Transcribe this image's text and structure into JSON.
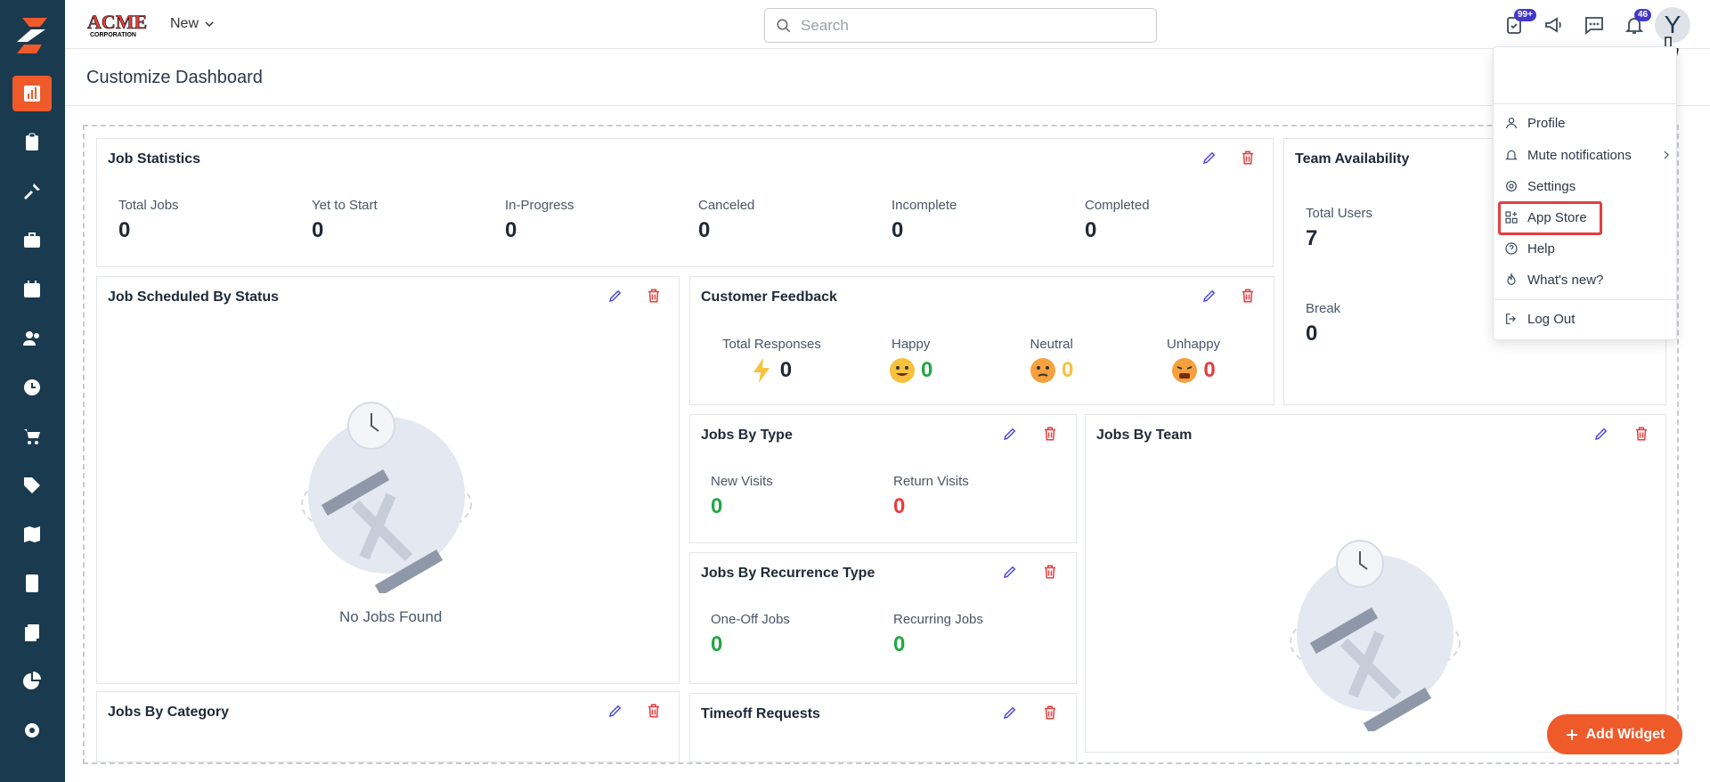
{
  "header": {
    "new_label": "New",
    "search_placeholder": "Search",
    "tasks_badge": "99+",
    "notifications_badge": "46",
    "avatar_letter": "Y"
  },
  "page": {
    "title": "Customize Dashboard"
  },
  "cards": {
    "job_statistics": {
      "title": "Job Statistics",
      "stats": [
        {
          "label": "Total Jobs",
          "value": "0"
        },
        {
          "label": "Yet to Start",
          "value": "0"
        },
        {
          "label": "In-Progress",
          "value": "0"
        },
        {
          "label": "Canceled",
          "value": "0"
        },
        {
          "label": "Incomplete",
          "value": "0"
        },
        {
          "label": "Completed",
          "value": "0"
        }
      ]
    },
    "team_availability": {
      "title": "Team Availability",
      "stats": [
        {
          "label": "Total Users",
          "value": "7"
        },
        {
          "label": "Break",
          "value": "0"
        }
      ]
    },
    "job_scheduled": {
      "title": "Job Scheduled By Status",
      "empty": "No Jobs Found"
    },
    "customer_feedback": {
      "title": "Customer Feedback",
      "stats": [
        {
          "label": "Total Responses",
          "value": "0"
        },
        {
          "label": "Happy",
          "value": "0"
        },
        {
          "label": "Neutral",
          "value": "0"
        },
        {
          "label": "Unhappy",
          "value": "0"
        }
      ]
    },
    "jobs_by_type": {
      "title": "Jobs By Type",
      "stats": [
        {
          "label": "New Visits",
          "value": "0"
        },
        {
          "label": "Return Visits",
          "value": "0"
        }
      ]
    },
    "jobs_by_team": {
      "title": "Jobs By Team"
    },
    "jobs_by_recurrence": {
      "title": "Jobs By Recurrence Type",
      "stats": [
        {
          "label": "One-Off Jobs",
          "value": "0"
        },
        {
          "label": "Recurring Jobs",
          "value": "0"
        }
      ]
    },
    "jobs_by_category": {
      "title": "Jobs By Category"
    },
    "timeoff_requests": {
      "title": "Timeoff Requests"
    }
  },
  "user_menu": {
    "items": [
      {
        "label": "Profile",
        "icon": "user-icon"
      },
      {
        "label": "Mute notifications",
        "icon": "bell-icon"
      },
      {
        "label": "Settings",
        "icon": "gear-icon"
      },
      {
        "label": "App Store",
        "icon": "apps-icon"
      },
      {
        "label": "Help",
        "icon": "help-icon"
      },
      {
        "label": "What's new?",
        "icon": "flame-icon"
      },
      {
        "label": "Log Out",
        "icon": "logout-icon"
      }
    ]
  },
  "add_widget_label": "Add Widget",
  "colors": {
    "sidebar": "#1a3a4f",
    "accent": "#ef5a2a",
    "edit": "#4f46e5",
    "delete": "#e53e3e",
    "positive": "#22a745"
  }
}
